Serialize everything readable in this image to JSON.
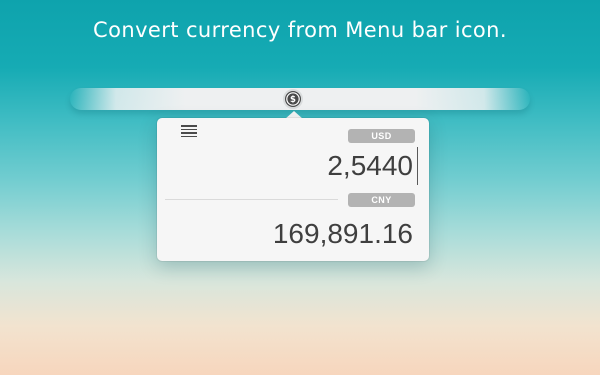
{
  "headline": "Convert currency from Menu bar icon.",
  "menubar": {
    "icon": "currency-exchange-icon"
  },
  "popover": {
    "menu_icon": "hamburger-menu-icon",
    "from_currency": "USD",
    "amount": "2,5440",
    "to_currency": "CNY",
    "result": "169,891.16"
  },
  "colors": {
    "badge_bg": "#b3b3b3",
    "popover_bg": "#f6f6f6",
    "text": "#3f3f3f"
  }
}
